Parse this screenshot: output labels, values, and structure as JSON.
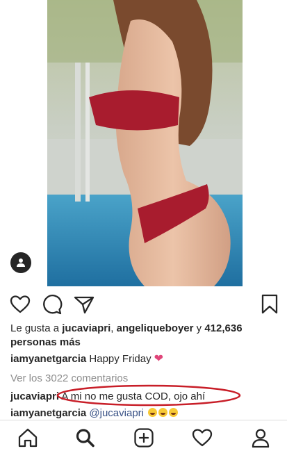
{
  "post": {
    "likes": {
      "prefix": "Le gusta a ",
      "user1": "jucaviapri",
      "separator": ", ",
      "user2": "angeliqueboyer",
      "joiner": " y ",
      "count": "412,636",
      "suffix": "personas más"
    },
    "caption": {
      "username": "iamyanetgarcia",
      "text": "Happy Friday",
      "emoji": "heart"
    },
    "view_comments_label": "Ver los 3022 comentarios",
    "comments": [
      {
        "username": "jucaviapri",
        "text": "A mi no me gusta COD, ojo ahí"
      },
      {
        "username": "iamyanetgarcia",
        "mention": "@jucaviapri",
        "emoji": "laughing-face x3"
      }
    ],
    "annotation_color": "#c81e28",
    "like_heart_color": "#e0467a"
  },
  "actions": [
    "heart-icon",
    "comment-icon",
    "share-icon",
    "bookmark-icon"
  ],
  "bottom_nav": [
    "home-icon",
    "search-icon",
    "new-post-icon",
    "activity-icon",
    "profile-icon"
  ]
}
